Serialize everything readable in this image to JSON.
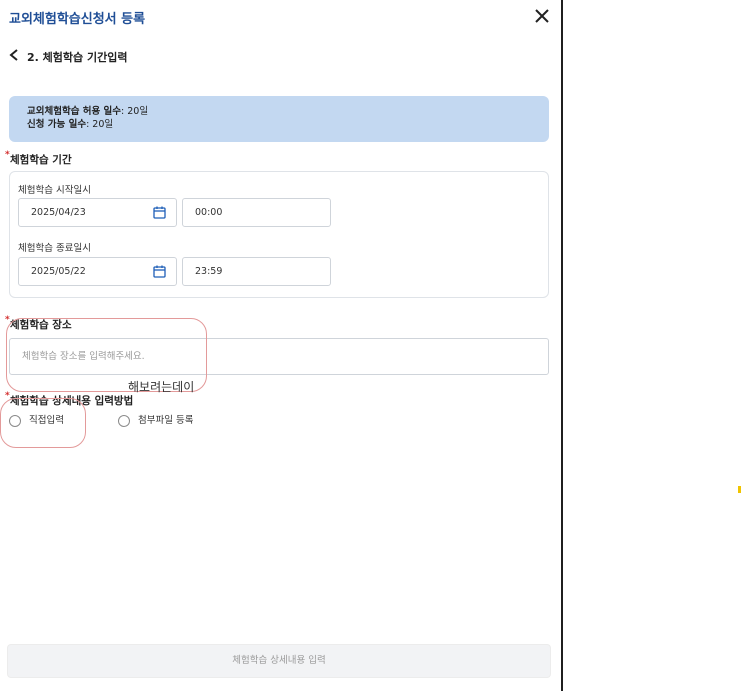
{
  "header": {
    "title": "교외체험학습신청서 등록"
  },
  "step": {
    "title": "2. 체험학습 기간입력"
  },
  "info": {
    "allowed_label": "교외체험학습 허용 일수",
    "allowed_value": ": 20일",
    "available_label": "신청 가능 일수",
    "available_value": ": 20일"
  },
  "period": {
    "label": "체험학습 기간",
    "start_label": "체험학습 시작일시",
    "start_date": "2025/04/23",
    "start_time": "00:00",
    "end_label": "체험학습 종료일시",
    "end_date": "2025/05/22",
    "end_time": "23:59"
  },
  "place": {
    "label": "체험학습 장소",
    "placeholder": "체험학습 장소를 입력해주세요."
  },
  "detail_method": {
    "label": "체험학습 상세내용 입력방법",
    "options": [
      "직접입력",
      "첨부파일 등록"
    ]
  },
  "annotation_text": "해보려는데이",
  "submit_label": "체험학습 상세내용 입력",
  "colors": {
    "title_blue": "#1f4e96",
    "info_bg": "#c3d8f1",
    "annotation_red": "#e39a9a",
    "required_red": "#d32f2f"
  }
}
